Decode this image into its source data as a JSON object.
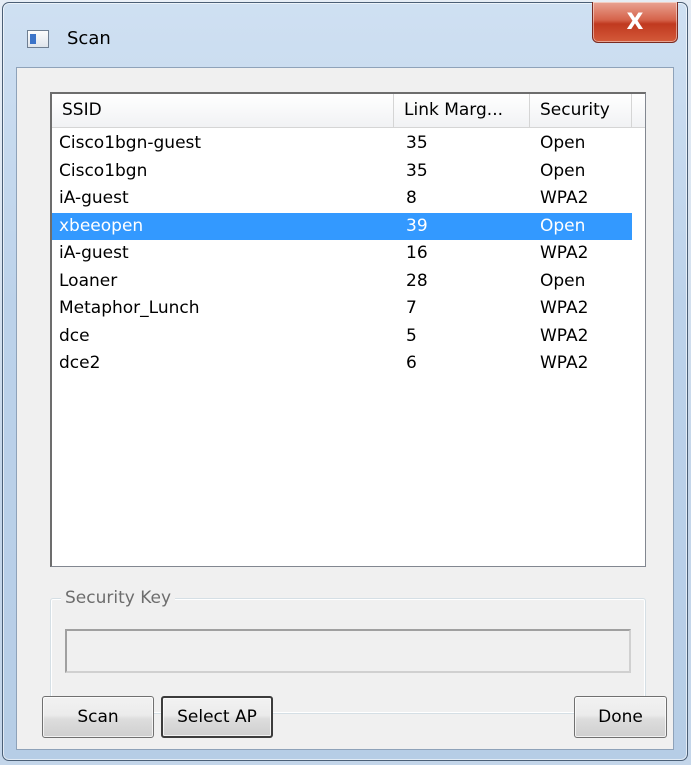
{
  "window": {
    "title": "Scan",
    "close_glyph": "X",
    "app_icon": "app-window-icon"
  },
  "list": {
    "columns": [
      "SSID",
      "Link Marg...",
      "Security"
    ],
    "rows": [
      {
        "ssid": "Cisco1bgn-guest",
        "link_margin": "35",
        "security": "Open"
      },
      {
        "ssid": "Cisco1bgn",
        "link_margin": "35",
        "security": "Open"
      },
      {
        "ssid": "iA-guest",
        "link_margin": "8",
        "security": "WPA2"
      },
      {
        "ssid": "xbeeopen",
        "link_margin": "39",
        "security": "Open"
      },
      {
        "ssid": "iA-guest",
        "link_margin": "16",
        "security": "WPA2"
      },
      {
        "ssid": "Loaner",
        "link_margin": "28",
        "security": "Open"
      },
      {
        "ssid": "Metaphor_Lunch",
        "link_margin": "7",
        "security": "WPA2"
      },
      {
        "ssid": "dce",
        "link_margin": "5",
        "security": "WPA2"
      },
      {
        "ssid": "dce2",
        "link_margin": "6",
        "security": "WPA2"
      }
    ],
    "selected_index": 3
  },
  "security_key": {
    "label": "Security Key",
    "value": ""
  },
  "buttons": {
    "scan": "Scan",
    "select_ap": "Select AP",
    "done": "Done"
  },
  "colors": {
    "selection": "#3399ff",
    "close_button": "#c0391f"
  }
}
